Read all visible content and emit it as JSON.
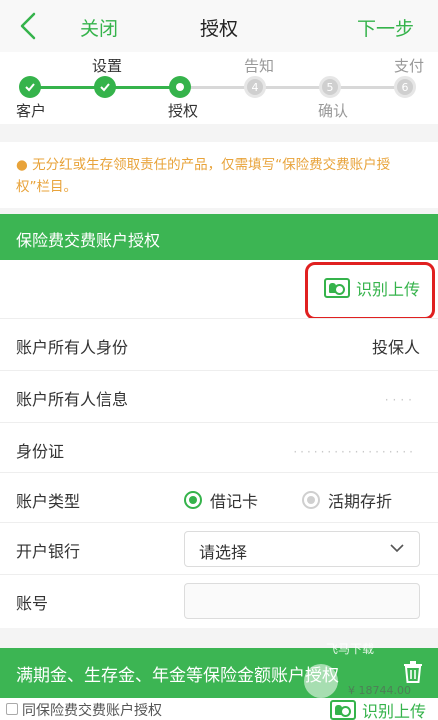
{
  "nav": {
    "close": "关闭",
    "title": "授权",
    "next": "下一步"
  },
  "stepper": {
    "steps": [
      {
        "label": "客户",
        "status": "done"
      },
      {
        "label": "设置",
        "status": "done"
      },
      {
        "label": "授权",
        "status": "current"
      },
      {
        "label": "告知",
        "status": "todo",
        "number": "4"
      },
      {
        "label": "确认",
        "status": "todo",
        "number": "5"
      },
      {
        "label": "支付",
        "status": "todo",
        "number": "6"
      }
    ]
  },
  "notice": "无分红或生存领取责任的产品，仅需填写“保险费交费账户授权”栏目。",
  "section1": {
    "title": "保险费交费账户授权",
    "upload_label": "识别上传",
    "owner_identity_label": "账户所有人身份",
    "owner_identity_value": "投保人",
    "owner_info_label": "账户所有人信息",
    "id_label": "身份证",
    "account_type_label": "账户类型",
    "account_type_options": [
      "借记卡",
      "活期存折"
    ],
    "account_type_selected": "借记卡",
    "bank_label": "开户银行",
    "bank_value": "请选择",
    "account_no_label": "账号",
    "account_no_value": ""
  },
  "section2": {
    "title": "满期金、生存金、年金等保险金额账户授权",
    "same_account_label": "同保险费交费账户授权",
    "upload_label": "识别上传"
  },
  "watermark": {
    "text1": "飞马下载",
    "text2": "¥ 18744.00"
  },
  "colors": {
    "accent": "#35b34b",
    "header_bg": "#3cb553",
    "notice": "#e8a33a",
    "highlight": "#e02020"
  }
}
